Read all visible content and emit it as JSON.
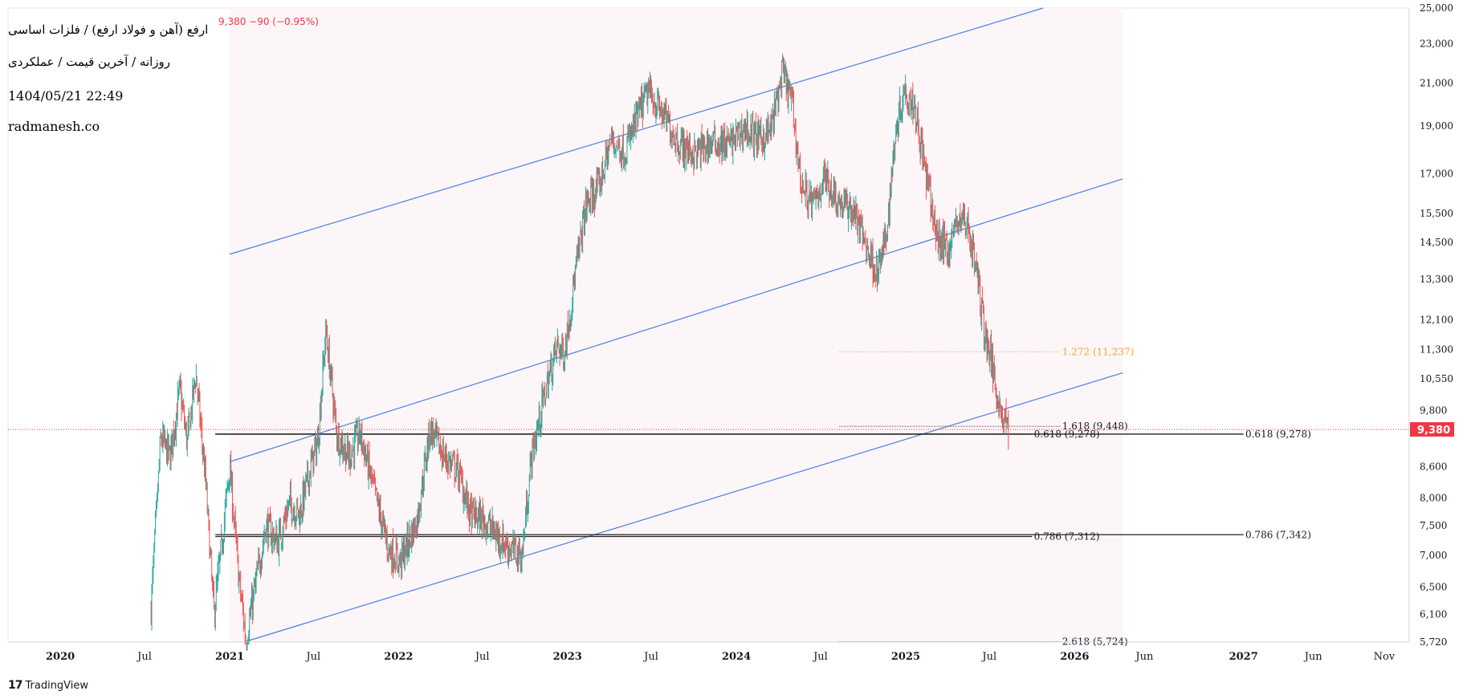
{
  "header": {
    "symbol_line": "ارفع (آهن و فولاد ارفع) / فلزات اساسی",
    "sub_line": "روزانه / آخرین قیمت / عملکردی",
    "datetime": "1404/05/21 22:49",
    "website": "radmanesh.co",
    "quote": "9,380  −90 (−0.95%)"
  },
  "footer": {
    "brand": "TradingView",
    "logo_icon": "tradingview-logo-icon"
  },
  "colors": {
    "up": "#26a69a",
    "down": "#ef5350",
    "channel": "#4a7fe0",
    "fib_orange": "#f5a623",
    "price_tag": "#f23645",
    "channel_fill": "#fdf6f8"
  },
  "chart_data": {
    "type": "candlestick",
    "title": "",
    "last_price": 9380,
    "last_price_label": "9,380",
    "y_scale": "log",
    "ylim": [
      5720,
      25000
    ],
    "y_ticks": [
      {
        "v": 25000,
        "label": "25,000"
      },
      {
        "v": 23000,
        "label": "23,000"
      },
      {
        "v": 21000,
        "label": "21,000"
      },
      {
        "v": 19000,
        "label": "19,000"
      },
      {
        "v": 17000,
        "label": "17,000"
      },
      {
        "v": 15500,
        "label": "15,500"
      },
      {
        "v": 14500,
        "label": "14,500"
      },
      {
        "v": 13300,
        "label": "13,300"
      },
      {
        "v": 12100,
        "label": "12,100"
      },
      {
        "v": 11300,
        "label": "11,300"
      },
      {
        "v": 10550,
        "label": "10,550"
      },
      {
        "v": 9800,
        "label": "9,800"
      },
      {
        "v": 8600,
        "label": "8,600"
      },
      {
        "v": 8000,
        "label": "8,000"
      },
      {
        "v": 7500,
        "label": "7,500"
      },
      {
        "v": 7000,
        "label": "7,000"
      },
      {
        "v": 6500,
        "label": "6,500"
      },
      {
        "v": 6100,
        "label": "6,100"
      },
      {
        "v": 5720,
        "label": "5,720"
      }
    ],
    "x_ticks": [
      {
        "t": "2020-01-01",
        "label": "2020",
        "bold": true
      },
      {
        "t": "2020-07-01",
        "label": "Jul"
      },
      {
        "t": "2021-01-01",
        "label": "2021",
        "bold": true
      },
      {
        "t": "2021-07-01",
        "label": "Jul"
      },
      {
        "t": "2022-01-01",
        "label": "2022",
        "bold": true
      },
      {
        "t": "2022-07-01",
        "label": "Jul"
      },
      {
        "t": "2023-01-01",
        "label": "2023",
        "bold": true
      },
      {
        "t": "2023-07-01",
        "label": "Jul"
      },
      {
        "t": "2024-01-01",
        "label": "2024",
        "bold": true
      },
      {
        "t": "2024-07-01",
        "label": "Jul"
      },
      {
        "t": "2025-01-01",
        "label": "2025",
        "bold": true
      },
      {
        "t": "2025-07-01",
        "label": "Jul"
      },
      {
        "t": "2026-01-01",
        "label": "2026",
        "bold": true
      },
      {
        "t": "2026-06-01",
        "label": "Jun"
      },
      {
        "t": "2027-01-01",
        "label": "2027",
        "bold": true
      },
      {
        "t": "2027-06-01",
        "label": "Jun"
      },
      {
        "t": "2027-11-01",
        "label": "Nov"
      }
    ],
    "price_path": [
      [
        "2020-07-15",
        6200
      ],
      [
        "2020-08-05",
        9200
      ],
      [
        "2020-08-25",
        8800
      ],
      [
        "2020-09-15",
        10300
      ],
      [
        "2020-10-01",
        9100
      ],
      [
        "2020-10-20",
        10700
      ],
      [
        "2020-11-10",
        8300
      ],
      [
        "2020-11-28",
        6100
      ],
      [
        "2020-12-15",
        7200
      ],
      [
        "2021-01-01",
        8600
      ],
      [
        "2021-01-20",
        6700
      ],
      [
        "2021-02-05",
        5750
      ],
      [
        "2021-02-25",
        6500
      ],
      [
        "2021-03-20",
        7500
      ],
      [
        "2021-04-15",
        7200
      ],
      [
        "2021-05-10",
        7900
      ],
      [
        "2021-06-01",
        7700
      ],
      [
        "2021-06-25",
        8600
      ],
      [
        "2021-07-10",
        9100
      ],
      [
        "2021-07-28",
        11800
      ],
      [
        "2021-08-20",
        9300
      ],
      [
        "2021-09-15",
        8800
      ],
      [
        "2021-10-10",
        9300
      ],
      [
        "2021-11-10",
        8100
      ],
      [
        "2021-12-10",
        7100
      ],
      [
        "2022-01-05",
        6900
      ],
      [
        "2022-02-10",
        7600
      ],
      [
        "2022-03-10",
        9400
      ],
      [
        "2022-04-10",
        8800
      ],
      [
        "2022-05-10",
        8500
      ],
      [
        "2022-06-05",
        7700
      ],
      [
        "2022-07-05",
        7600
      ],
      [
        "2022-08-05",
        7300
      ],
      [
        "2022-09-01",
        7100
      ],
      [
        "2022-09-25",
        7000
      ],
      [
        "2022-10-15",
        8800
      ],
      [
        "2022-11-15",
        10300
      ],
      [
        "2022-12-10",
        11400
      ],
      [
        "2022-12-25",
        11200
      ],
      [
        "2023-01-20",
        13700
      ],
      [
        "2023-02-10",
        15800
      ],
      [
        "2023-03-10",
        16500
      ],
      [
        "2023-04-05",
        18400
      ],
      [
        "2023-05-05",
        17900
      ],
      [
        "2023-06-05",
        19600
      ],
      [
        "2023-06-25",
        20600
      ],
      [
        "2023-08-01",
        19300
      ],
      [
        "2023-09-01",
        18200
      ],
      [
        "2023-10-05",
        17800
      ],
      [
        "2023-11-10",
        18300
      ],
      [
        "2023-12-15",
        18200
      ],
      [
        "2024-01-20",
        18900
      ],
      [
        "2024-02-20",
        18400
      ],
      [
        "2024-03-15",
        18800
      ],
      [
        "2024-04-10",
        21500
      ],
      [
        "2024-04-30",
        20100
      ],
      [
        "2024-05-20",
        16600
      ],
      [
        "2024-06-15",
        15800
      ],
      [
        "2024-07-10",
        16900
      ],
      [
        "2024-08-10",
        15900
      ],
      [
        "2024-09-10",
        15600
      ],
      [
        "2024-10-10",
        14300
      ],
      [
        "2024-11-01",
        13500
      ],
      [
        "2024-11-20",
        14700
      ],
      [
        "2024-12-10",
        18800
      ],
      [
        "2024-12-28",
        20700
      ],
      [
        "2025-01-20",
        20000
      ],
      [
        "2025-02-15",
        16800
      ],
      [
        "2025-03-10",
        14600
      ],
      [
        "2025-04-05",
        14300
      ],
      [
        "2025-04-25",
        15400
      ],
      [
        "2025-05-15",
        15100
      ],
      [
        "2025-06-05",
        13400
      ],
      [
        "2025-06-20",
        11800
      ],
      [
        "2025-07-05",
        11000
      ],
      [
        "2025-07-25",
        9800
      ],
      [
        "2025-08-12",
        9380
      ]
    ],
    "channel": {
      "upper": [
        [
          "2021-01-01",
          14100
        ],
        [
          "2025-10-25",
          25000
        ]
      ],
      "middle": [
        [
          "2021-01-01",
          8700
        ],
        [
          "2026-04-15",
          16800
        ]
      ],
      "lower": [
        [
          "2021-02-01",
          5720
        ],
        [
          "2026-04-15",
          10700
        ]
      ],
      "fill_from": "2021-01-01",
      "fill_to": "2026-04-15"
    },
    "fib_levels": [
      {
        "label": "1.272 (11,237)",
        "value": 11237,
        "from": "2024-08-10",
        "to": "2025-12-01",
        "style": "orange-dotted",
        "label_at": "2025-12-05"
      },
      {
        "label": "1.618 (9,448)",
        "value": 9448,
        "from": "2024-08-10",
        "to": "2025-12-01",
        "style": "thin",
        "label_at": "2025-12-05"
      },
      {
        "label": "2.618 (5,724)",
        "value": 5724,
        "from": "2024-08-10",
        "to": "2025-12-01",
        "style": "thin",
        "label_at": "2025-12-05"
      },
      {
        "label": "0.618 (9,278)",
        "value": 9278,
        "from": "2020-12-01",
        "to": "2027-01-01",
        "style": "solid",
        "label_at": "2027-01-05"
      },
      {
        "label": "0.618 (9,278)",
        "value": 9278,
        "from": "2020-12-01",
        "to": "2025-10-01",
        "style": "solid",
        "label_at": "2025-10-05"
      },
      {
        "label": "0.786 (7,342)",
        "value": 7342,
        "from": "2020-12-01",
        "to": "2027-01-01",
        "style": "solid",
        "label_at": "2027-01-05"
      },
      {
        "label": "0.786 (7,312)",
        "value": 7312,
        "from": "2020-12-01",
        "to": "2025-10-01",
        "style": "solid",
        "label_at": "2025-10-05"
      }
    ]
  }
}
